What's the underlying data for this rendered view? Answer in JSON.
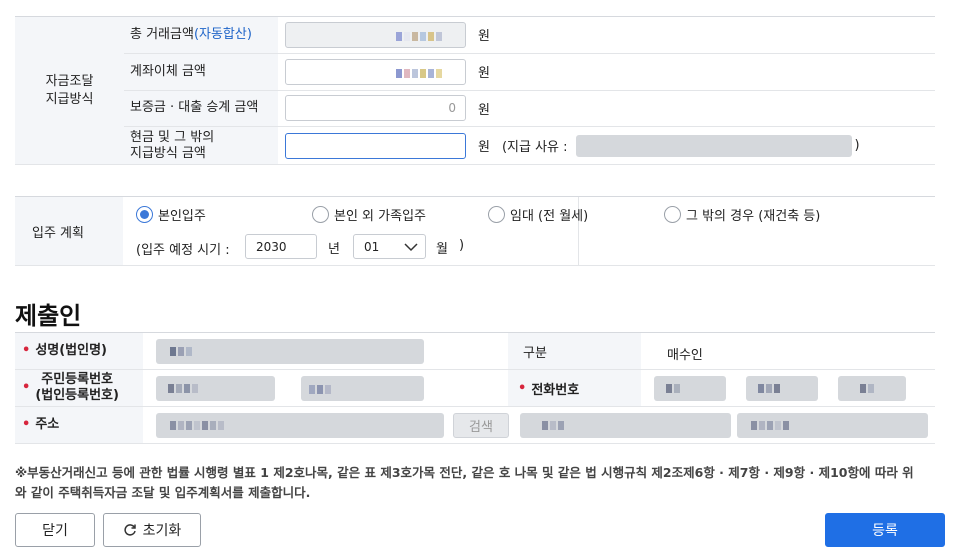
{
  "funding": {
    "group_label": "자금조달\n지급방식",
    "rows": [
      {
        "label": "총 거래금액",
        "label_link": "(자동합산)",
        "value": "",
        "unit": "원"
      },
      {
        "label": "계좌이체 금액",
        "value": "",
        "unit": "원"
      },
      {
        "label": "보증금 · 대출 승계 금액",
        "value": "0",
        "unit": "원"
      },
      {
        "label": "현금 및 그 밖의\n지급방식 금액",
        "value": "",
        "unit": "원",
        "reason_label": "(지급 사유 :",
        "reason_close": ")"
      }
    ]
  },
  "move_in": {
    "label": "입주 계획",
    "options": [
      "본인입주",
      "본인 외 가족입주",
      "임대 (전 월세)",
      "그 밖의 경우 (재건축 등)"
    ],
    "selected": "본인입주",
    "schedule_label": "(입주 예정 시기 :",
    "year": "2030",
    "year_unit": "년",
    "month": "01",
    "month_unit": "월",
    "schedule_close": ")"
  },
  "submitter": {
    "title": "제출인",
    "name_label": "성명(법인명)",
    "category_label": "구분",
    "category_value": "매수인",
    "id_label": "주민등록번호\n(법인등록번호)",
    "phone_label": "전화번호",
    "address_label": "주소",
    "search_label": "검색"
  },
  "note": "※부동산거래신고 등에 관한 법률 시행령 별표 1 제2호나목, 같은 표 제3호가목 전단, 같은 호 나목 및 같은 법 시행규칙 제2조제6항 · 제7항 · 제9항 · 제10항에 따라 위와 같이 주택취득자금 조달 및 입주계획서를 제출합니다.",
  "buttons": {
    "close": "닫기",
    "reset": "초기화",
    "submit": "등록"
  },
  "colors": {
    "accent": "#1f6fe5",
    "required_dot": "#d7263d",
    "header_bg": "#f4f6f9"
  }
}
